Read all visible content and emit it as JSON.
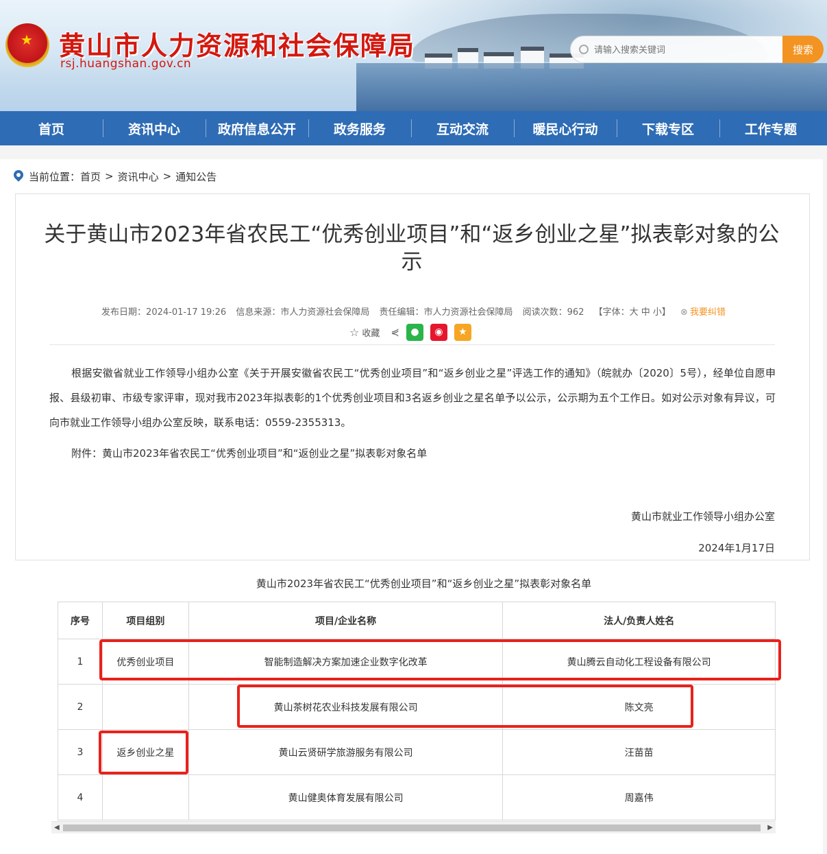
{
  "header": {
    "site_title": "黄山市人力资源和社会保障局",
    "site_domain": "rsj.huangshan.gov.cn",
    "search_placeholder": "请输入搜索关键词",
    "search_button": "搜索"
  },
  "nav": {
    "items": [
      "首页",
      "资讯中心",
      "政府信息公开",
      "政务服务",
      "互动交流",
      "暖民心行动",
      "下载专区",
      "工作专题"
    ]
  },
  "breadcrumb": {
    "prefix": "当前位置：",
    "items": [
      "首页",
      "资讯中心",
      "通知公告"
    ],
    "sep": ">"
  },
  "article": {
    "title": "关于黄山市2023年省农民工“优秀创业项目”和“返乡创业之星”拟表彰对象的公示",
    "meta": {
      "date": "发布日期：2024-01-17 19:26",
      "source": "信息来源：市人力资源社会保障局",
      "editor": "责任编辑：市人力资源社会保障局",
      "views": "阅读次数：962",
      "font": "【字体：大 中 小】",
      "correct": "我要纠错"
    },
    "share": {
      "favorite": "收藏"
    },
    "body": "根据安徽省就业工作领导小组办公室《关于开展安徽省农民工“优秀创业项目”和“返乡创业之星”评选工作的通知》（皖就办〔2020〕5号），经单位自愿申报、县级初审、市级专家评审，现对我市2023年拟表彰的1个优秀创业项目和3名返乡创业之星名单予以公示，公示期为五个工作日。如对公示对象有异议，可向市就业工作领导小组办公室反映，联系电话：0559-2355313。",
    "attachment": "附件：黄山市2023年省农民工“优秀创业项目”和“返创业之星”拟表彰对象名单",
    "signature": "黄山市就业工作领导小组办公室",
    "sign_date": "2024年1月17日"
  },
  "table": {
    "caption": "黄山市2023年省农民工“优秀创业项目”和“返乡创业之星”拟表彰对象名单",
    "headers": [
      "序号",
      "项目组别",
      "项目/企业名称",
      "法人/负责人姓名"
    ],
    "rows": [
      [
        "1",
        "优秀创业项目",
        "智能制造解决方案加速企业数字化改革",
        "黄山腾云自动化工程设备有限公司"
      ],
      [
        "2",
        "",
        "黄山茶树花农业科技发展有限公司",
        "陈文亮"
      ],
      [
        "3",
        "返乡创业之星",
        "黄山云贤研学旅游服务有限公司",
        "汪苗苗"
      ],
      [
        "4",
        "",
        "黄山健奥体育发展有限公司",
        "周嘉伟"
      ]
    ]
  },
  "colors": {
    "nav_bg": "#2e6cb5",
    "title_red": "#d3180f",
    "search_orange": "#f39321",
    "highlight_red": "#e8221b"
  }
}
